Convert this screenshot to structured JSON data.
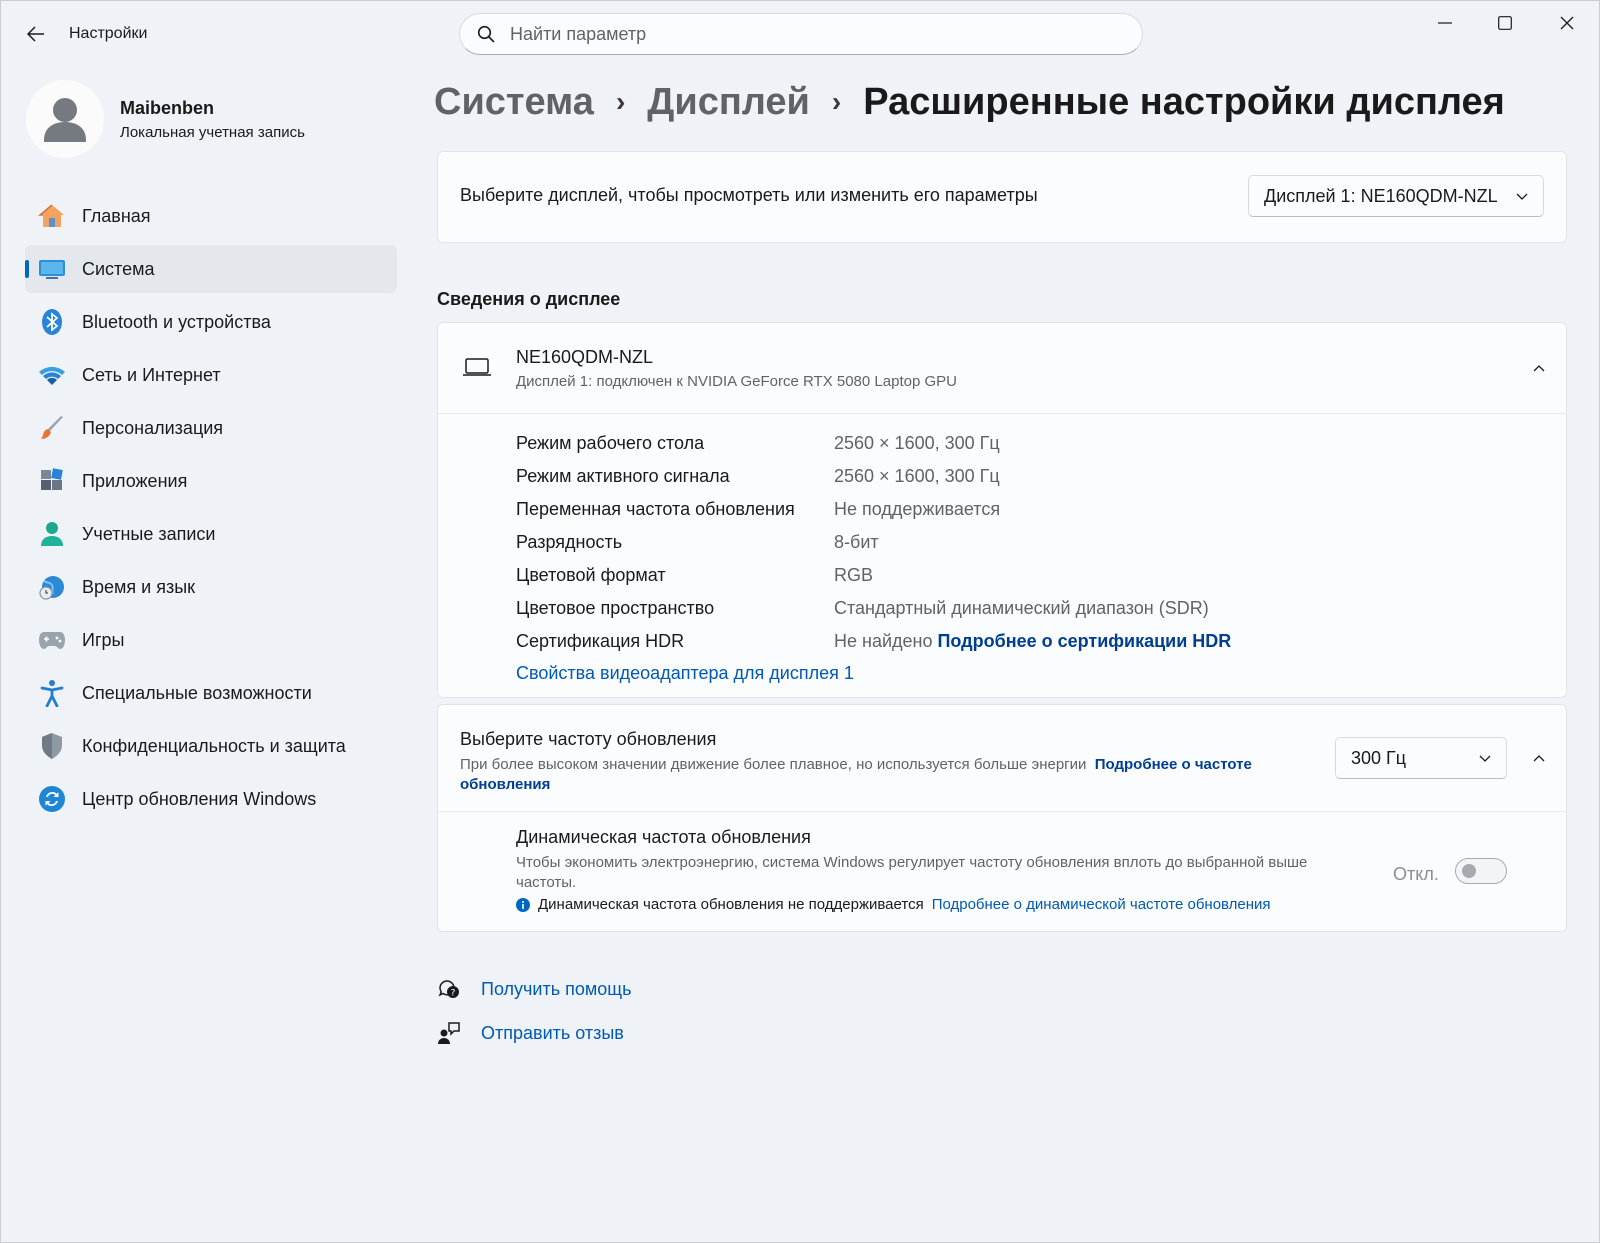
{
  "window": {
    "app_title": "Настройки",
    "search_placeholder": "Найти параметр"
  },
  "profile": {
    "name": "Maibenben",
    "account_type": "Локальная учетная запись"
  },
  "sidebar": {
    "items": [
      {
        "label": "Главная",
        "icon": "home-icon",
        "active": false
      },
      {
        "label": "Система",
        "icon": "system-display-icon",
        "active": true
      },
      {
        "label": "Bluetooth и устройства",
        "icon": "bluetooth-icon",
        "active": false
      },
      {
        "label": "Сеть и Интернет",
        "icon": "wifi-icon",
        "active": false
      },
      {
        "label": "Персонализация",
        "icon": "brush-icon",
        "active": false
      },
      {
        "label": "Приложения",
        "icon": "apps-icon",
        "active": false
      },
      {
        "label": "Учетные записи",
        "icon": "person-icon",
        "active": false
      },
      {
        "label": "Время и язык",
        "icon": "globe-clock-icon",
        "active": false
      },
      {
        "label": "Игры",
        "icon": "gamepad-icon",
        "active": false
      },
      {
        "label": "Специальные возможности",
        "icon": "accessibility-icon",
        "active": false
      },
      {
        "label": "Конфиденциальность и защита",
        "icon": "shield-icon",
        "active": false
      },
      {
        "label": "Центр обновления Windows",
        "icon": "windows-update-icon",
        "active": false
      }
    ]
  },
  "breadcrumb": {
    "level1": "Система",
    "level2": "Дисплей",
    "current": "Расширенные настройки дисплея"
  },
  "display_select": {
    "label": "Выберите дисплей, чтобы просмотреть или изменить его параметры",
    "selected": "Дисплей 1: NE160QDM-NZL"
  },
  "display_info": {
    "section_title": "Сведения о дисплее",
    "name": "NE160QDM-NZL",
    "subtitle": "Дисплей 1: подключен к NVIDIA GeForce RTX 5080 Laptop GPU",
    "specs": [
      {
        "key": "Режим рабочего стола",
        "value": "2560 × 1600, 300 Гц",
        "link": ""
      },
      {
        "key": "Режим активного сигнала",
        "value": "2560 × 1600, 300 Гц",
        "link": ""
      },
      {
        "key": "Переменная частота обновления",
        "value": "Не поддерживается",
        "link": ""
      },
      {
        "key": "Разрядность",
        "value": "8-бит",
        "link": ""
      },
      {
        "key": "Цветовой формат",
        "value": "RGB",
        "link": ""
      },
      {
        "key": "Цветовое пространство",
        "value": "Стандартный динамический диапазон (SDR)",
        "link": ""
      },
      {
        "key": "Сертификация HDR",
        "value": "Не найдено",
        "link": "Подробнее о сертификации HDR"
      }
    ],
    "adapter_link": "Свойства видеоадаптера для дисплея 1"
  },
  "refresh_rate": {
    "title": "Выберите частоту обновления",
    "description": "При более высоком значении движение более плавное, но используется больше энергии",
    "learn_more": "Подробнее о частоте обновления",
    "selected": "300 Гц"
  },
  "dynamic_refresh": {
    "title": "Динамическая частота обновления",
    "description": "Чтобы экономить электроэнергию, система Windows регулирует частоту обновления вплоть до выбранной выше частоты.",
    "note": "Динамическая частота обновления не поддерживается",
    "note_link": "Подробнее о динамической частоте обновления",
    "toggle_state": "Откл.",
    "enabled": false
  },
  "footer": {
    "help": "Получить помощь",
    "feedback": "Отправить отзыв"
  },
  "colors": {
    "accent": "#0067c0",
    "link": "#0059b3"
  }
}
